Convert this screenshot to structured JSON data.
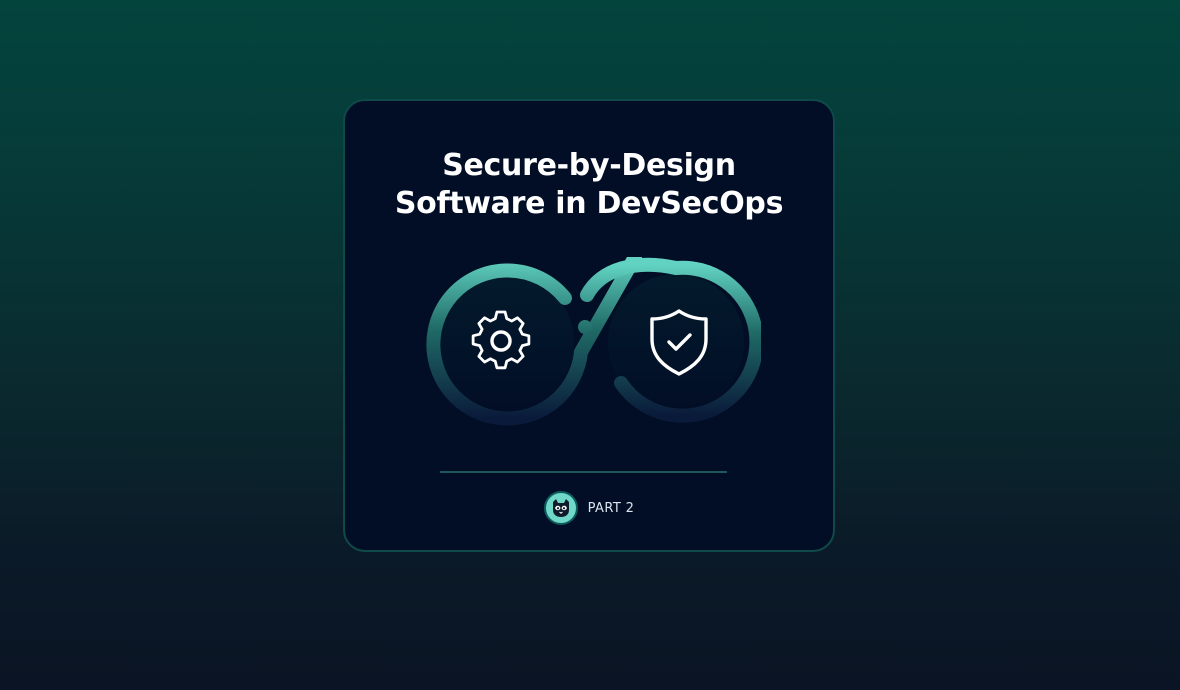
{
  "card": {
    "title_line_1": "Secure-by-Design",
    "title_line_2": "Software in DevSecOps"
  },
  "footer": {
    "part_label": "PART 2",
    "avatar_icon": "mascot-icon"
  },
  "icons": {
    "left": "gear-icon",
    "right": "shield-check-icon",
    "loop": "infinity-loop"
  },
  "colors": {
    "background_top": "#03443d",
    "background_bottom": "#0b1424",
    "card_background": "#020e26",
    "card_border": "#0f4a4a",
    "accent": "#6fd8c9",
    "text": "#ffffff"
  }
}
